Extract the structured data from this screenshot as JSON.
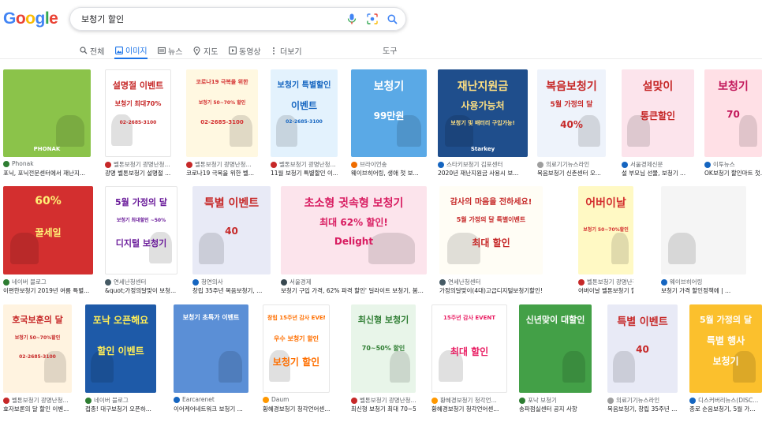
{
  "header": {
    "logo": [
      "G",
      "o",
      "o",
      "g",
      "l",
      "e"
    ],
    "logo_colors": [
      "#4285f4",
      "#ea4335",
      "#fbbc05",
      "#4285f4",
      "#34a853",
      "#ea4335"
    ],
    "query": "보청기 할인"
  },
  "tabs": [
    {
      "label": "전체",
      "icon": "search-icon",
      "active": false
    },
    {
      "label": "이미지",
      "icon": "image-icon",
      "active": true
    },
    {
      "label": "뉴스",
      "icon": "news-icon",
      "active": false
    },
    {
      "label": "지도",
      "icon": "map-pin-icon",
      "active": false
    },
    {
      "label": "동영상",
      "icon": "video-icon",
      "active": false
    },
    {
      "label": "더보기",
      "icon": "more-icon",
      "active": false
    }
  ],
  "tools_label": "도구",
  "results": [
    {
      "source": "Phonak",
      "title": "포닉, 포닉전문센터에서 재난지...",
      "bg": "#8bc34a",
      "fav": "#2e7d32",
      "lines": [],
      "lines_color": "#ffffff",
      "sub": "PHONAK"
    },
    {
      "source": "벨톤보청기 광명난청...",
      "title": "광명 벨톤보청기 설명절 ...",
      "bg": "#ffffff",
      "fav": "#c62828",
      "lines": [
        "설명절 이벤트",
        "보청기 최대70%",
        "02-2685-3100"
      ],
      "lines_color": "#c62828"
    },
    {
      "source": "벨톤보청기 광명난청...",
      "title": "코로나19 극복을 위한 벨...",
      "bg": "#fff8e1",
      "fav": "#c62828",
      "lines": [
        "코로나19 극복을 위한",
        "보청기 50~70% 할인",
        "02-2685-3100"
      ],
      "lines_color": "#d32f2f"
    },
    {
      "source": "벨톤보청기 광명난청...",
      "title": "11월 보청기 특별할인 이...",
      "bg": "#e3f2fd",
      "fav": "#c62828",
      "lines": [
        "보청기 특별할인",
        "이벤트",
        "02-2685-3100"
      ],
      "lines_color": "#1565c0"
    },
    {
      "source": "브라이언송",
      "title": "웨이브히어링, 생애 첫 보...",
      "bg": "#5aa9e6",
      "fav": "#ef6c00",
      "lines": [
        "보청기",
        "99만원"
      ],
      "lines_color": "#ffffff"
    },
    {
      "source": "스타키보청기 김포센터",
      "title": "2020년 재난지원금 사용시 보...",
      "bg": "#1f4e8c",
      "fav": "#1565c0",
      "lines": [
        "재난지원금",
        "사용가능처",
        "보청기 및 배터리 구입가능!"
      ],
      "lines_color": "#ffe082",
      "sub": "Starkey"
    },
    {
      "source": "의료기기뉴스라인",
      "title": "복음보청기 신촌센터 오...",
      "bg": "#eef3fb",
      "fav": "#9e9e9e",
      "lines": [
        "복음보청기",
        "5월 가정의 달",
        "40%"
      ],
      "lines_color": "#c62828"
    },
    {
      "source": "서울경제신문",
      "title": "설 부모님 선물, 보청기 ...",
      "bg": "#fce4ec",
      "fav": "#1565c0",
      "lines": [
        "설맞이",
        "통큰할인"
      ],
      "lines_color": "#c62828"
    },
    {
      "source": "이투뉴스",
      "title": "OK보청기 할인마트 첫...",
      "bg": "#ffe0e6",
      "fav": "#1565c0",
      "lines": [
        "보청기",
        "70"
      ],
      "lines_color": "#c2185b"
    },
    {
      "source": "네이버 블로그",
      "title": "이편한보청기 2019년 여름 특별...",
      "bg": "#d32f2f",
      "fav": "#2e7d32",
      "lines": [
        "60%",
        "꿀세일"
      ],
      "lines_color": "#fff176"
    },
    {
      "source": "연세난청센터",
      "title": "&quot;가정의달맞이 보청...",
      "bg": "#ffffff",
      "fav": "#455a64",
      "lines": [
        "5월 가정의 달",
        "보청기 최대할인 ~50%",
        "디지털 보청기"
      ],
      "lines_color": "#6a1b9a"
    },
    {
      "source": "청연의사",
      "title": "창립 35주년 복음보청기, ...",
      "bg": "#e8eaf6",
      "fav": "#1565c0",
      "lines": [
        "특별 이벤트",
        "40"
      ],
      "lines_color": "#c62828"
    },
    {
      "source": "서울경제",
      "title": "보청기 구입 가격, 62% 파격 할인' 딜라이트 보청기, 봄...",
      "bg": "#fce4ec",
      "fav": "#37474f",
      "lines": [
        "초소형 귓속형 보청기",
        "최대 62% 할인!",
        "Delight"
      ],
      "lines_color": "#d81b60"
    },
    {
      "source": "연세난청센터",
      "title": "가정의달맞이(4대)고급디지털보청기할인!? : ...",
      "bg": "#fffdf5",
      "fav": "#455a64",
      "lines": [
        "감사의 마음을 전하세요!",
        "5월 가정의 달 특별이벤트",
        "최대 할인"
      ],
      "lines_color": "#c62828"
    },
    {
      "source": "벨톤보청기 광명난청...",
      "title": "어버이날 벨톤보청기 할인 ...",
      "bg": "#fff9c4",
      "fav": "#c62828",
      "lines": [
        "어버이날",
        "보청기 50~70%할인"
      ],
      "lines_color": "#d32f2f"
    },
    {
      "source": "웨이브히어링",
      "title": "보청기 가격 할인정책에 | ...",
      "bg": "#f5f5f5",
      "fav": "#1565c0",
      "lines": [],
      "lines_color": "#333333"
    },
    {
      "source": "벨톤보청기 광명난청...",
      "title": "효자보론의 달 할인 이벤...",
      "bg": "#fff3e0",
      "fav": "#c62828",
      "lines": [
        "호국보훈의 달",
        "보청기 50~70%할인",
        "02-2685-3100"
      ],
      "lines_color": "#c62828"
    },
    {
      "source": "네이버 블로그",
      "title": "접종! 대구보청기 오픈하...",
      "bg": "#1e5aa8",
      "fav": "#2e7d32",
      "lines": [
        "포낙 오픈해요",
        "할인 이벤트"
      ],
      "lines_color": "#ffee58"
    },
    {
      "source": "Earcarenet",
      "title": "이어케어네트워크 보청기 ...",
      "bg": "#5b8fd6",
      "fav": "#1565c0",
      "lines": [
        "보청기 초특가 이벤트"
      ],
      "lines_color": "#ffffff"
    },
    {
      "source": "Daum",
      "title": "황혜경보청기 청각언어센...",
      "bg": "#ffffff",
      "fav": "#ff9800",
      "lines": [
        "창립 15주년 감사 EVENT",
        "우수 보청기 할인",
        "보청기 할인"
      ],
      "lines_color": "#ff6f00"
    },
    {
      "source": "벨톤보청기 광명난청...",
      "title": "최신형 보청기 최대 70~5...",
      "bg": "#e8f5e9",
      "fav": "#c62828",
      "lines": [
        "최신형 보청기",
        "70~50% 할인"
      ],
      "lines_color": "#2e7d32"
    },
    {
      "source": "황혜경보청기 청각언...",
      "title": "황혜경보청기 청각언어센...",
      "bg": "#fff",
      "fav": "#ff9800",
      "lines": [
        "15주년 감사 EVENT",
        "최대 할인"
      ],
      "lines_color": "#e91e63"
    },
    {
      "source": "포낙 보청기",
      "title": "송파점실센터 공지 사항",
      "bg": "#43a047",
      "fav": "#2e7d32",
      "lines": [
        "신년맞이 대할인"
      ],
      "lines_color": "#ffffff"
    },
    {
      "source": "의료기기뉴스라인",
      "title": "복음보청기, 창립 35주년 ...",
      "bg": "#e8eaf6",
      "fav": "#9e9e9e",
      "lines": [
        "특별 이벤트",
        "40"
      ],
      "lines_color": "#c62828"
    },
    {
      "source": "디스커버리뉴스(DISC...",
      "title": "종로 순음보청기, 5월 가...",
      "bg": "#fbc02d",
      "fav": "#1565c0",
      "lines": [
        "5월 가정의 달",
        "특별 행사",
        "보청기"
      ],
      "lines_color": "#ffffff"
    }
  ]
}
